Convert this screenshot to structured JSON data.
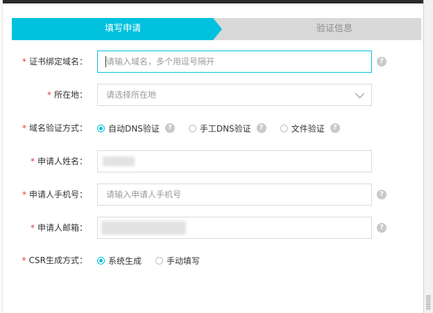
{
  "steps": [
    {
      "label": "填写申请",
      "active": true
    },
    {
      "label": "验证信息",
      "active": false
    }
  ],
  "form": {
    "domain": {
      "label": "证书绑定域名：",
      "placeholder": "请输入域名，多个用逗号隔开"
    },
    "location": {
      "label": "所在地：",
      "placeholder": "请选择所在地"
    },
    "verify_method": {
      "label": "域名验证方式：",
      "options": [
        {
          "label": "自动DNS验证",
          "checked": true
        },
        {
          "label": "手工DNS验证",
          "checked": false
        },
        {
          "label": "文件验证",
          "checked": false
        }
      ]
    },
    "applicant_name": {
      "label": "申请人姓名："
    },
    "applicant_phone": {
      "label": "申请人手机号：",
      "placeholder": "请输入申请人手机号"
    },
    "applicant_email": {
      "label": "申请人邮箱："
    },
    "csr_method": {
      "label": "CSR生成方式：",
      "options": [
        {
          "label": "系统生成",
          "checked": true
        },
        {
          "label": "手动填写",
          "checked": false
        }
      ]
    }
  },
  "icons": {
    "help": "question-circle-icon",
    "dropdown": "chevron-down-icon"
  },
  "colors": {
    "accent": "#00c1de",
    "required": "#e4393c",
    "step_inactive": "#d9d9d9"
  },
  "help_glyph": "?",
  "required_mark": "*"
}
